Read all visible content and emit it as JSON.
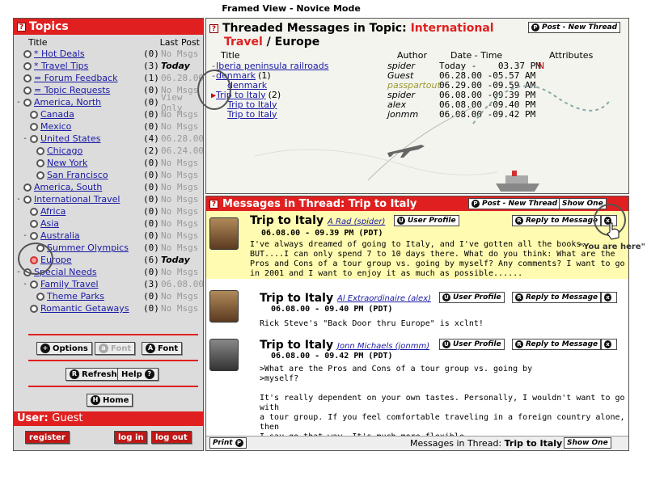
{
  "caption": "Framed View - Novice Mode",
  "left": {
    "title": "Topics",
    "col_title": "Title",
    "col_last": "Last Post",
    "topics": [
      {
        "label": "* Hot Deals",
        "count": "(0)",
        "last": "No Msgs",
        "indent": 0,
        "exp": "",
        "today": false
      },
      {
        "label": "* Travel Tips",
        "count": "(3)",
        "last": "Today",
        "indent": 0,
        "exp": "",
        "today": true
      },
      {
        "label": "= Forum Feedback",
        "count": "(1)",
        "last": "06.28.00",
        "indent": 0,
        "exp": "",
        "today": false
      },
      {
        "label": "= Topic Requests",
        "count": "(0)",
        "last": "No Msgs",
        "indent": 0,
        "exp": "",
        "today": false
      },
      {
        "label": "America, North",
        "count": "(0)",
        "last": "View Only",
        "indent": 0,
        "exp": "-",
        "today": false
      },
      {
        "label": "Canada",
        "count": "(0)",
        "last": "No Msgs",
        "indent": 1,
        "exp": "",
        "today": false
      },
      {
        "label": "Mexico",
        "count": "(0)",
        "last": "No Msgs",
        "indent": 1,
        "exp": "",
        "today": false
      },
      {
        "label": "United States",
        "count": "(4)",
        "last": "06.28.00",
        "indent": 1,
        "exp": "-",
        "today": false
      },
      {
        "label": "Chicago",
        "count": "(2)",
        "last": "06.24.00",
        "indent": 2,
        "exp": "",
        "today": false
      },
      {
        "label": "New York",
        "count": "(0)",
        "last": "No Msgs",
        "indent": 2,
        "exp": "",
        "today": false
      },
      {
        "label": "San Francisco",
        "count": "(0)",
        "last": "No Msgs",
        "indent": 2,
        "exp": "",
        "today": false
      },
      {
        "label": "America, South",
        "count": "(0)",
        "last": "No Msgs",
        "indent": 0,
        "exp": "",
        "today": false
      },
      {
        "label": "International Travel",
        "count": "(0)",
        "last": "No Msgs",
        "indent": 0,
        "exp": "-",
        "today": false
      },
      {
        "label": "Africa",
        "count": "(0)",
        "last": "No Msgs",
        "indent": 1,
        "exp": "",
        "today": false
      },
      {
        "label": "Asia",
        "count": "(0)",
        "last": "No Msgs",
        "indent": 1,
        "exp": "",
        "today": false
      },
      {
        "label": "Australia",
        "count": "(0)",
        "last": "No Msgs",
        "indent": 1,
        "exp": "-",
        "today": false
      },
      {
        "label": "Summer Olympics",
        "count": "(0)",
        "last": "No Msgs",
        "indent": 2,
        "exp": "",
        "today": false
      },
      {
        "label": "Europe",
        "count": "(6)",
        "last": "Today",
        "indent": 1,
        "exp": "",
        "today": true,
        "active": true
      },
      {
        "label": "Special Needs",
        "count": "(0)",
        "last": "No Msgs",
        "indent": 0,
        "exp": "-",
        "today": false
      },
      {
        "label": "Family Travel",
        "count": "(3)",
        "last": "06.08.00",
        "indent": 1,
        "exp": "-",
        "today": false
      },
      {
        "label": "Theme Parks",
        "count": "(0)",
        "last": "No Msgs",
        "indent": 2,
        "exp": "",
        "today": false
      },
      {
        "label": "Romantic Getaways",
        "count": "(0)",
        "last": "No Msgs",
        "indent": 1,
        "exp": "",
        "today": false
      }
    ],
    "buttons": {
      "options": "Options",
      "font_small": "Font",
      "font_large": "Font",
      "refresh": "Refresh",
      "help": "Help",
      "home": "Home",
      "register": "register",
      "login": "log in",
      "logout": "log out"
    },
    "user_label": "User:",
    "user_value": "Guest"
  },
  "threads": {
    "title_prefix": "Threaded Messages in Topic:",
    "topic": "International",
    "topic2": "Travel",
    "sub": "/ Europe",
    "post_new": "Post - New Thread",
    "cols": {
      "title": "Title",
      "author": "Author",
      "date": "Date - Time",
      "attr": "Attributes"
    },
    "rows": [
      {
        "title": "Iberia peninsula railroads",
        "author": "spider",
        "date": "Today -    03.37 PM",
        "attr": "N",
        "indent": 0,
        "exp": "-"
      },
      {
        "title": "denmark",
        "suffix": "(1)",
        "author": "Guest",
        "date": "06.28.00 -05.57 AM",
        "attr": "",
        "indent": 0,
        "exp": "-"
      },
      {
        "title": "denmark",
        "author": "passpartout",
        "date": "06.29.00 -09.59 AM",
        "attr": "",
        "indent": 1,
        "exp": "",
        "author_green": true
      },
      {
        "title": "Trip to Italy",
        "suffix": "(2)",
        "author": "spider",
        "date": "06.08.00 -09.39 PM",
        "attr": "",
        "indent": 0,
        "exp": "-",
        "current": true
      },
      {
        "title": "Trip to Italy",
        "author": "alex",
        "date": "06.08.00 -09.40 PM",
        "attr": "",
        "indent": 1,
        "exp": ""
      },
      {
        "title": "Trip to Italy",
        "author": "jonmm",
        "date": "06.08.00 -09.42 PM",
        "attr": "",
        "indent": 1,
        "exp": ""
      }
    ]
  },
  "messages": {
    "title": "Messages in Thread: Trip to Italy",
    "post_new": "Post - New Thread",
    "show_one": "Show One",
    "user_profile": "User Profile",
    "reply": "Reply to Message",
    "you_are_here": "\"You are here\"",
    "items": [
      {
        "subject": "Trip to Italy",
        "author": "A Rad (spider)",
        "date": "06.08.00 - 09.39 PM (PDT)",
        "body": "I've always dreamed of going to Italy, and I've gotten all the books.\nBUT....I can only spend 7 to 10 days there. What do you think: What are the\nPros and Cons of a tour group vs. going by myself? Any comments? I want to go\nin 2001 and I want to enjoy it as much as possible......"
      },
      {
        "subject": "Trip to Italy",
        "author": "Al Extraordinaire (alex)",
        "date": "06.08.00 - 09.40 PM (PDT)",
        "body": "Rick Steve's \"Back Door thru Europe\" is xclnt!"
      },
      {
        "subject": "Trip to Italy",
        "author": "Jonn Michaels (jonmm)",
        "date": "06.08.00 - 09.42 PM (PDT)",
        "body": ">What are the Pros and Cons of a tour group vs. going by\n>myself?\n\nIt's really dependent on your own tastes. Personally, I wouldn't want to go with\na tour group. If you feel comfortable traveling in a foreign country alone, then\nI say go that way. It's much more flexible."
      }
    ],
    "print": "Print",
    "footer_label": "Messages in Thread:",
    "footer_thread": "Trip to Italy",
    "footer_show": "Show One"
  }
}
